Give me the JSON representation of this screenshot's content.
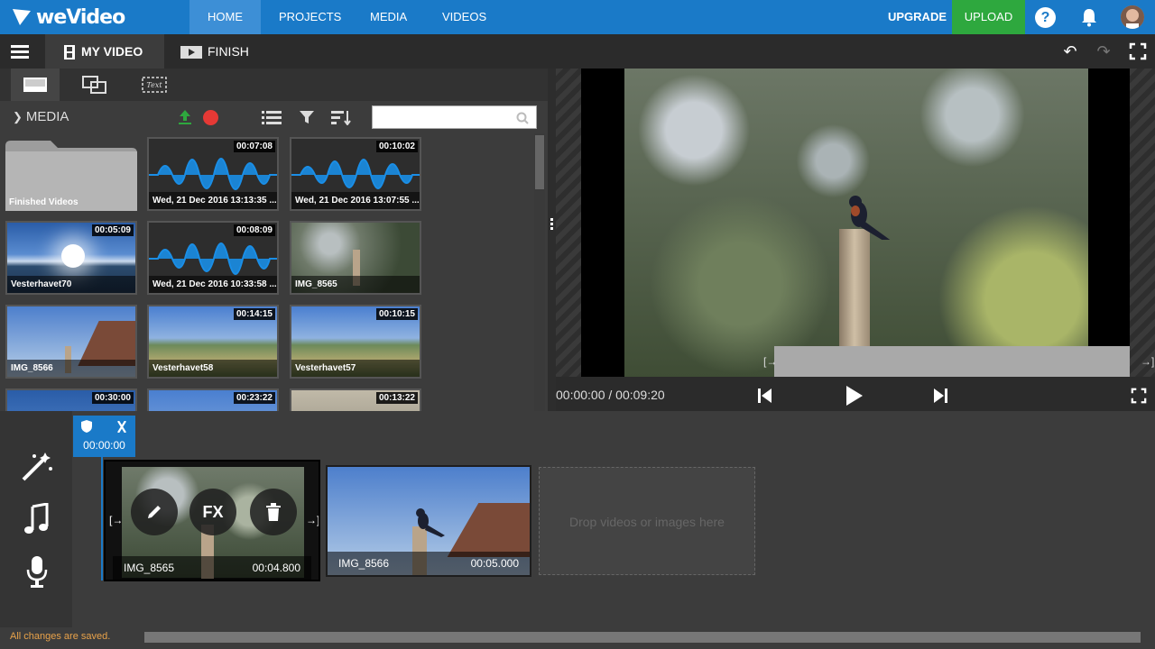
{
  "topnav": {
    "logo": "weVideo",
    "items": [
      "HOME",
      "PROJECTS",
      "MEDIA",
      "VIDEOS"
    ],
    "upgrade": "UPGRADE",
    "upload": "UPLOAD",
    "help": "?"
  },
  "toolbar": {
    "my_video": "MY VIDEO",
    "finish": "FINISH"
  },
  "media": {
    "label": "MEDIA",
    "search_placeholder": "",
    "items": [
      {
        "name": "Finished Videos",
        "duration": ""
      },
      {
        "name": "Wed, 21 Dec 2016 13:13:35 ...",
        "duration": "00:07:08"
      },
      {
        "name": "Wed, 21 Dec 2016 13:07:55 ...",
        "duration": "00:10:02"
      },
      {
        "name": "Vesterhavet70",
        "duration": "00:05:09"
      },
      {
        "name": "Wed, 21 Dec 2016 10:33:58 ...",
        "duration": "00:08:09"
      },
      {
        "name": "IMG_8565",
        "duration": ""
      },
      {
        "name": "IMG_8566",
        "duration": ""
      },
      {
        "name": "Vesterhavet58",
        "duration": "00:14:15"
      },
      {
        "name": "Vesterhavet57",
        "duration": "00:10:15"
      },
      {
        "name": "",
        "duration": "00:30:00"
      },
      {
        "name": "",
        "duration": "00:23:22"
      },
      {
        "name": "",
        "duration": "00:13:22"
      }
    ]
  },
  "preview": {
    "timecode": "00:00:00 / 00:09:20"
  },
  "timeline": {
    "playhead_time": "00:00:00",
    "clips": [
      {
        "name": "IMG_8565",
        "duration": "00:04.800"
      },
      {
        "name": "IMG_8566",
        "duration": "00:05.000"
      }
    ],
    "fx_label": "FX",
    "drop_text": "Drop videos or images here"
  },
  "status": {
    "text": "All changes are saved."
  },
  "colors": {
    "brand_blue": "#1a7ac8",
    "upload_green": "#2ea83e",
    "status_orange": "#e8a24a"
  }
}
